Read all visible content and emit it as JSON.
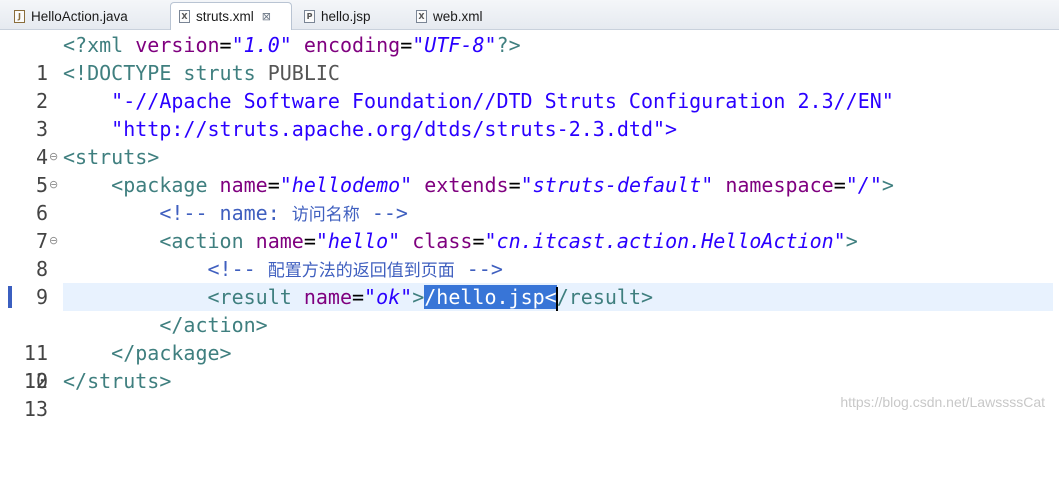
{
  "tabs": [
    {
      "label": "HelloAction.java",
      "icon": "java-file-icon",
      "active": false
    },
    {
      "label": "struts.xml",
      "icon": "xml-file-icon",
      "active": true,
      "close": "⊠"
    },
    {
      "label": "hello.jsp",
      "icon": "jsp-file-icon",
      "active": false
    },
    {
      "label": "web.xml",
      "icon": "xml-file-icon",
      "active": false
    }
  ],
  "lines": [
    {
      "num": "1"
    },
    {
      "num": "2"
    },
    {
      "num": "3"
    },
    {
      "num": "4"
    },
    {
      "num": "5",
      "fold": "⊖"
    },
    {
      "num": "6",
      "fold": "⊖"
    },
    {
      "num": "7"
    },
    {
      "num": "8",
      "fold": "⊖"
    },
    {
      "num": "9"
    },
    {
      "num": "10",
      "current": true
    },
    {
      "num": "11"
    },
    {
      "num": "12"
    },
    {
      "num": "13"
    }
  ],
  "code": {
    "l1": {
      "a": "<?xml ",
      "b": "version",
      "c": "=",
      "d": "\"1.0\"",
      "e": " ",
      "f": "encoding",
      "g": "=",
      "h": "\"UTF-8\"",
      "i": "?>"
    },
    "l2": {
      "a": "<!DOCTYPE ",
      "b": "struts",
      "c": " PUBLIC"
    },
    "l3": {
      "a": "    \"-//Apache Software Foundation//DTD Struts Configuration 2.3//EN\""
    },
    "l4": {
      "a": "    \"http://struts.apache.org/dtds/struts-2.3.dtd\">"
    },
    "l5": {
      "a": "<struts>"
    },
    "l6": {
      "a": "    <package ",
      "b": "name",
      "c": "=",
      "d": "\"hellodemo\"",
      "e": " ",
      "f": "extends",
      "g": "=",
      "h": "\"struts-default\"",
      "i": " ",
      "j": "namespace",
      "k": "=",
      "l": "\"/\"",
      "m": ">"
    },
    "l7": {
      "a": "        <!-- name: ",
      "b": "访问名称",
      "c": " -->"
    },
    "l8": {
      "a": "        <action ",
      "b": "name",
      "c": "=",
      "d": "\"hello\"",
      "e": " ",
      "f": "class",
      "g": "=",
      "h": "\"cn.itcast.action.HelloAction\"",
      "i": ">"
    },
    "l9": {
      "a": "            <!-- ",
      "b": "配置方法的返回值到页面",
      "c": " -->"
    },
    "l10": {
      "a": "            <result ",
      "b": "name",
      "c": "=",
      "d": "\"ok\"",
      "e": ">",
      "f": "/hello.jsp<",
      "g": "/result>"
    },
    "l11": {
      "a": "        </action>"
    },
    "l12": {
      "a": "    </package>"
    },
    "l13": {
      "a": "</struts>"
    }
  },
  "watermark": "https://blog.csdn.net/LawssssCat"
}
